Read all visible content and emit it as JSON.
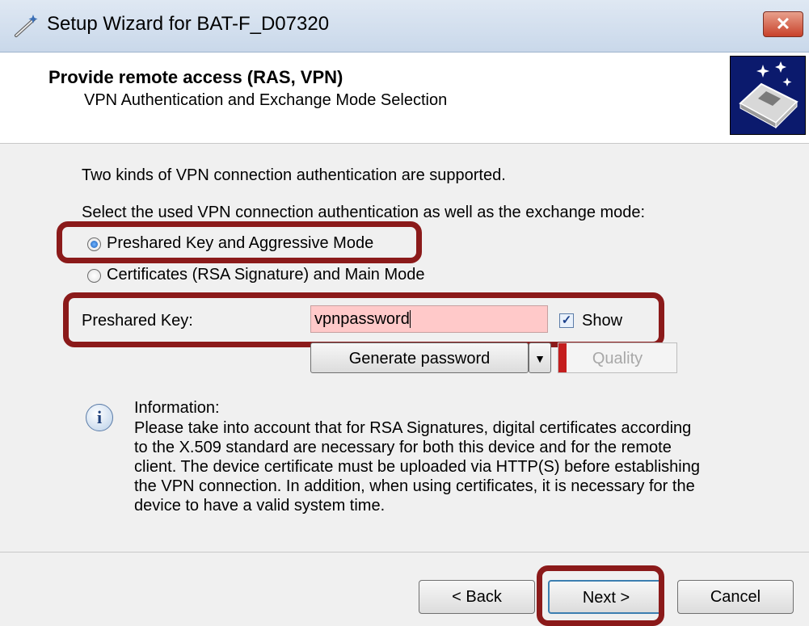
{
  "window": {
    "title": "Setup Wizard for BAT-F_D07320",
    "close_label": "✕"
  },
  "header": {
    "title": "Provide remote access (RAS, VPN)",
    "subtitle": "VPN Authentication and Exchange Mode Selection"
  },
  "body": {
    "intro": "Two kinds of VPN connection authentication are supported.",
    "select_prompt": "Select the used VPN connection authentication as well as the exchange mode:",
    "options": [
      {
        "label": "Preshared Key and Aggressive Mode",
        "selected": true
      },
      {
        "label": "Certificates (RSA Signature) and Main Mode",
        "selected": false
      }
    ],
    "psk_label": "Preshared Key:",
    "psk_value": "vpnpassword",
    "show_label": "Show",
    "show_checked": true,
    "generate_label": "Generate password",
    "quality_label": "Quality"
  },
  "info": {
    "title": "Information:",
    "lines": [
      "Please take into account that for RSA Signatures, digital certificates according",
      "to the X.509 standard are necessary for both this device and for the remote",
      "client. The device certificate must be uploaded via HTTP(S) before establishing",
      "the VPN connection. In addition, when using certificates, it is necessary for the",
      "device to have a valid system time."
    ]
  },
  "footer": {
    "back_label": "< Back",
    "next_label": "Next >",
    "cancel_label": "Cancel"
  },
  "colors": {
    "highlight": "#8b1a1a",
    "psk_field_bg": "#ffc9c9",
    "header_logo_bg": "#0b1a6d"
  }
}
